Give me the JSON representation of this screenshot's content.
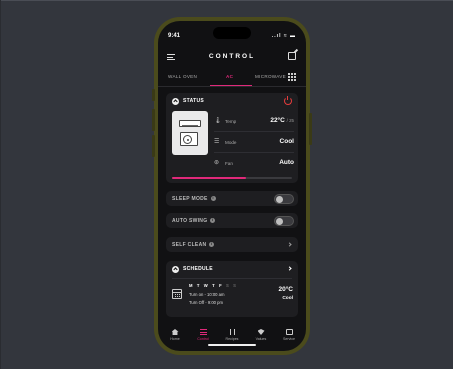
{
  "statusbar": {
    "time": "9:41",
    "icons": "..ıl ≈ ▬"
  },
  "header": {
    "title": "CONTROL"
  },
  "tabs": [
    {
      "label": "WALL OVEN",
      "active": false
    },
    {
      "label": "AC",
      "active": true
    },
    {
      "label": "MICROWAVE",
      "active": false
    }
  ],
  "status_card": {
    "title": "STATUS",
    "rows": [
      {
        "icon": "thermometer-icon",
        "label": "Temp",
        "value": "22°C",
        "suffix": "/ 25"
      },
      {
        "icon": "mode-icon",
        "label": "Mode",
        "value": "Cool"
      },
      {
        "icon": "fan-icon",
        "label": "Fan",
        "value": "Auto"
      }
    ],
    "progress": 0.62
  },
  "sleep_mode": {
    "label": "SLEEP MODE",
    "on": false
  },
  "auto_swing": {
    "label": "AUTO SWING",
    "on": false
  },
  "self_clean": {
    "label": "SELF CLEAN"
  },
  "schedule": {
    "title": "SCHEDULE",
    "days": [
      {
        "d": "M",
        "on": true
      },
      {
        "d": "T",
        "on": true
      },
      {
        "d": "W",
        "on": true
      },
      {
        "d": "T",
        "on": true
      },
      {
        "d": "F",
        "on": true
      },
      {
        "d": "S",
        "on": false
      },
      {
        "d": "S",
        "on": false
      }
    ],
    "turn_on": "Turn on - 10:00 am",
    "turn_off": "Turn Off - 9:00 pm",
    "temp": "20°C",
    "mode": "Cool"
  },
  "bottom_nav": [
    {
      "label": "Home",
      "icon": "home-icon",
      "active": false
    },
    {
      "label": "Control",
      "icon": "control-icon",
      "active": true
    },
    {
      "label": "Recipes",
      "icon": "recipes-icon",
      "active": false
    },
    {
      "label": "Values",
      "icon": "values-icon",
      "active": false
    },
    {
      "label": "Service",
      "icon": "service-icon",
      "active": false
    }
  ],
  "colors": {
    "accent": "#e0297a",
    "power": "#e53c3c",
    "card": "#1e1e21",
    "screen": "#111113",
    "frame": "#4b4b1c",
    "background": "#33363d"
  }
}
